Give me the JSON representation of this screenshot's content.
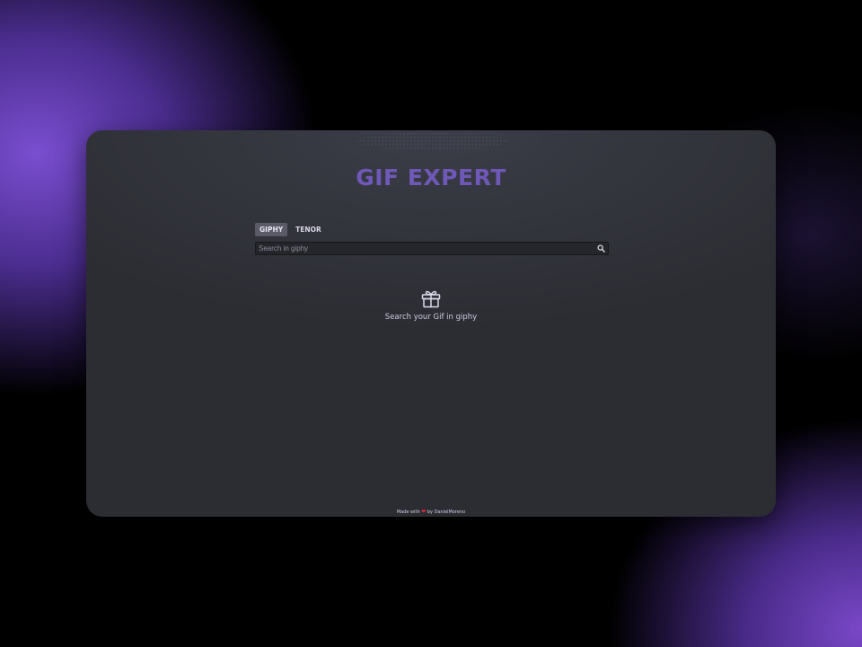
{
  "app": {
    "title": "GIF EXPERT"
  },
  "tabs": [
    {
      "label": "GIPHY",
      "active": true
    },
    {
      "label": "TENOR",
      "active": false
    }
  ],
  "search": {
    "placeholder": "Search in giphy",
    "value": "",
    "icon": "search-icon"
  },
  "empty_state": {
    "icon": "gift-icon",
    "message": "Search your Gif in giphy"
  },
  "footer": {
    "prefix": "Made with",
    "heart_icon": "heart-icon",
    "heart_glyph": "❤",
    "suffix": "by DanielMoreno"
  },
  "colors": {
    "accent": "#6f58b8",
    "card_bg": "#2c2d33",
    "heart": "#e0283a"
  }
}
